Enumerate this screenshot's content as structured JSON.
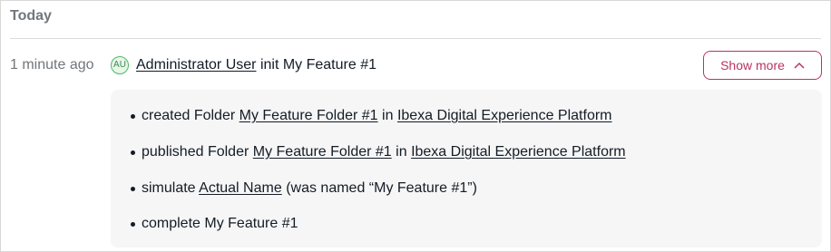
{
  "group": {
    "title": "Today"
  },
  "entry": {
    "time": "1 minute ago",
    "avatar_initials": "AU",
    "user": "Administrator User",
    "action": "init My Feature #1",
    "show_more_label": "Show more",
    "chevron_icon": "chevron-up-icon"
  },
  "details": [
    {
      "prefix": "created Folder",
      "link1": "My Feature Folder #1",
      "middle": "in",
      "link2": "Ibexa Digital Experience Platform"
    },
    {
      "prefix": "published Folder",
      "link1": "My Feature Folder #1",
      "middle": "in",
      "link2": "Ibexa Digital Experience Platform"
    },
    {
      "prefix": "simulate",
      "link1": "Actual Name",
      "suffix": "(was named “My Feature #1”)"
    },
    {
      "text": "complete My Feature #1"
    }
  ],
  "colors": {
    "accent": "#b9355f",
    "muted": "#71767c",
    "avatar": "#58b368"
  }
}
